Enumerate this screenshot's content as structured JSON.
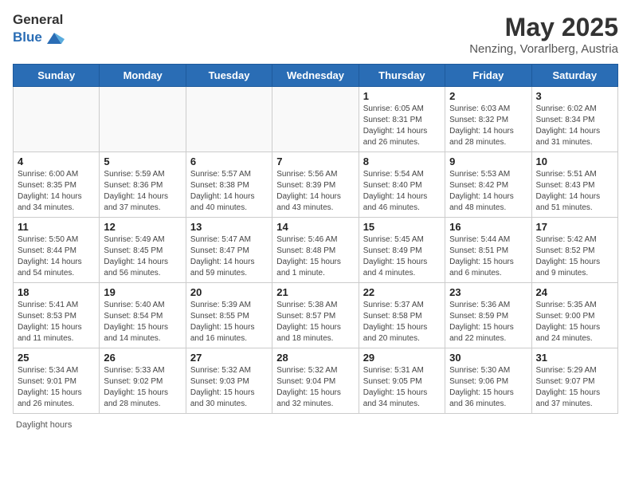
{
  "header": {
    "logo_general": "General",
    "logo_blue": "Blue",
    "month_title": "May 2025",
    "subtitle": "Nenzing, Vorarlberg, Austria"
  },
  "days_of_week": [
    "Sunday",
    "Monday",
    "Tuesday",
    "Wednesday",
    "Thursday",
    "Friday",
    "Saturday"
  ],
  "weeks": [
    [
      {
        "day": "",
        "info": ""
      },
      {
        "day": "",
        "info": ""
      },
      {
        "day": "",
        "info": ""
      },
      {
        "day": "",
        "info": ""
      },
      {
        "day": "1",
        "info": "Sunrise: 6:05 AM\nSunset: 8:31 PM\nDaylight: 14 hours\nand 26 minutes."
      },
      {
        "day": "2",
        "info": "Sunrise: 6:03 AM\nSunset: 8:32 PM\nDaylight: 14 hours\nand 28 minutes."
      },
      {
        "day": "3",
        "info": "Sunrise: 6:02 AM\nSunset: 8:34 PM\nDaylight: 14 hours\nand 31 minutes."
      }
    ],
    [
      {
        "day": "4",
        "info": "Sunrise: 6:00 AM\nSunset: 8:35 PM\nDaylight: 14 hours\nand 34 minutes."
      },
      {
        "day": "5",
        "info": "Sunrise: 5:59 AM\nSunset: 8:36 PM\nDaylight: 14 hours\nand 37 minutes."
      },
      {
        "day": "6",
        "info": "Sunrise: 5:57 AM\nSunset: 8:38 PM\nDaylight: 14 hours\nand 40 minutes."
      },
      {
        "day": "7",
        "info": "Sunrise: 5:56 AM\nSunset: 8:39 PM\nDaylight: 14 hours\nand 43 minutes."
      },
      {
        "day": "8",
        "info": "Sunrise: 5:54 AM\nSunset: 8:40 PM\nDaylight: 14 hours\nand 46 minutes."
      },
      {
        "day": "9",
        "info": "Sunrise: 5:53 AM\nSunset: 8:42 PM\nDaylight: 14 hours\nand 48 minutes."
      },
      {
        "day": "10",
        "info": "Sunrise: 5:51 AM\nSunset: 8:43 PM\nDaylight: 14 hours\nand 51 minutes."
      }
    ],
    [
      {
        "day": "11",
        "info": "Sunrise: 5:50 AM\nSunset: 8:44 PM\nDaylight: 14 hours\nand 54 minutes."
      },
      {
        "day": "12",
        "info": "Sunrise: 5:49 AM\nSunset: 8:45 PM\nDaylight: 14 hours\nand 56 minutes."
      },
      {
        "day": "13",
        "info": "Sunrise: 5:47 AM\nSunset: 8:47 PM\nDaylight: 14 hours\nand 59 minutes."
      },
      {
        "day": "14",
        "info": "Sunrise: 5:46 AM\nSunset: 8:48 PM\nDaylight: 15 hours\nand 1 minute."
      },
      {
        "day": "15",
        "info": "Sunrise: 5:45 AM\nSunset: 8:49 PM\nDaylight: 15 hours\nand 4 minutes."
      },
      {
        "day": "16",
        "info": "Sunrise: 5:44 AM\nSunset: 8:51 PM\nDaylight: 15 hours\nand 6 minutes."
      },
      {
        "day": "17",
        "info": "Sunrise: 5:42 AM\nSunset: 8:52 PM\nDaylight: 15 hours\nand 9 minutes."
      }
    ],
    [
      {
        "day": "18",
        "info": "Sunrise: 5:41 AM\nSunset: 8:53 PM\nDaylight: 15 hours\nand 11 minutes."
      },
      {
        "day": "19",
        "info": "Sunrise: 5:40 AM\nSunset: 8:54 PM\nDaylight: 15 hours\nand 14 minutes."
      },
      {
        "day": "20",
        "info": "Sunrise: 5:39 AM\nSunset: 8:55 PM\nDaylight: 15 hours\nand 16 minutes."
      },
      {
        "day": "21",
        "info": "Sunrise: 5:38 AM\nSunset: 8:57 PM\nDaylight: 15 hours\nand 18 minutes."
      },
      {
        "day": "22",
        "info": "Sunrise: 5:37 AM\nSunset: 8:58 PM\nDaylight: 15 hours\nand 20 minutes."
      },
      {
        "day": "23",
        "info": "Sunrise: 5:36 AM\nSunset: 8:59 PM\nDaylight: 15 hours\nand 22 minutes."
      },
      {
        "day": "24",
        "info": "Sunrise: 5:35 AM\nSunset: 9:00 PM\nDaylight: 15 hours\nand 24 minutes."
      }
    ],
    [
      {
        "day": "25",
        "info": "Sunrise: 5:34 AM\nSunset: 9:01 PM\nDaylight: 15 hours\nand 26 minutes."
      },
      {
        "day": "26",
        "info": "Sunrise: 5:33 AM\nSunset: 9:02 PM\nDaylight: 15 hours\nand 28 minutes."
      },
      {
        "day": "27",
        "info": "Sunrise: 5:32 AM\nSunset: 9:03 PM\nDaylight: 15 hours\nand 30 minutes."
      },
      {
        "day": "28",
        "info": "Sunrise: 5:32 AM\nSunset: 9:04 PM\nDaylight: 15 hours\nand 32 minutes."
      },
      {
        "day": "29",
        "info": "Sunrise: 5:31 AM\nSunset: 9:05 PM\nDaylight: 15 hours\nand 34 minutes."
      },
      {
        "day": "30",
        "info": "Sunrise: 5:30 AM\nSunset: 9:06 PM\nDaylight: 15 hours\nand 36 minutes."
      },
      {
        "day": "31",
        "info": "Sunrise: 5:29 AM\nSunset: 9:07 PM\nDaylight: 15 hours\nand 37 minutes."
      }
    ]
  ],
  "footer": {
    "daylight_label": "Daylight hours"
  }
}
